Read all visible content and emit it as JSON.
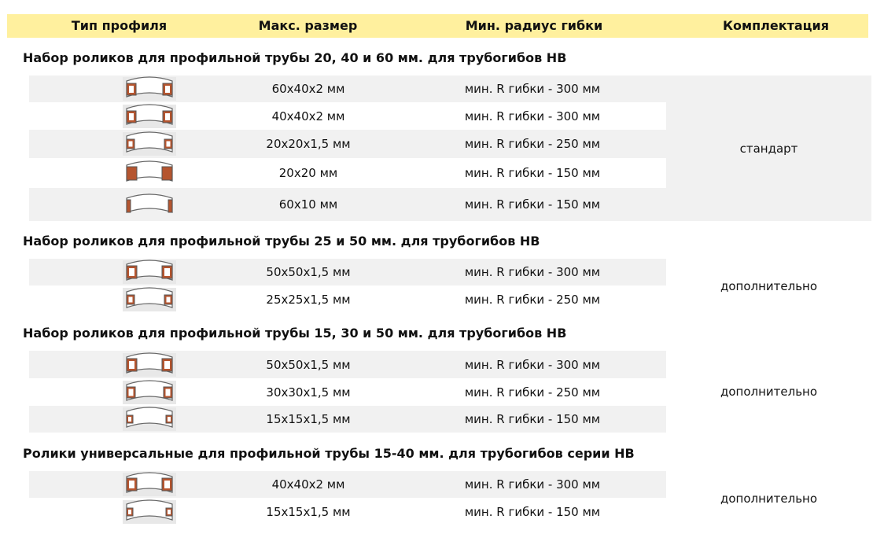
{
  "columns": {
    "type": "Тип профиля",
    "size": "Макс. размер",
    "radius": "Мин. радиус гибки",
    "kit": "Комплектация"
  },
  "groups": [
    {
      "title": "Набор роликов для профильной трубы 20, 40 и 60 мм. для трубогибов HB",
      "kit": "стандарт",
      "rows": [
        {
          "size": "60x40x2 мм",
          "radius": "мин. R гибки - 300 мм",
          "icon": "roller-hollow-square-icon"
        },
        {
          "size": "40x40x2 мм",
          "radius": "мин. R гибки - 300 мм",
          "icon": "roller-hollow-square-icon"
        },
        {
          "size": "20x20x1,5 мм",
          "radius": "мин. R гибки - 250 мм",
          "icon": "roller-hollow-square-icon"
        },
        {
          "size": "20x20 мм",
          "radius": "мин. R гибки - 150 мм",
          "icon": "roller-solid-square-icon"
        },
        {
          "size": "60x10 мм",
          "radius": "мин. R гибки - 150 мм",
          "icon": "roller-solid-flat-icon"
        }
      ]
    },
    {
      "title": "Набор роликов для профильной трубы 25 и 50 мм. для трубогибов HB",
      "kit": "дополнительно",
      "rows": [
        {
          "size": "50x50x1,5 мм",
          "radius": "мин. R гибки - 300 мм",
          "icon": "roller-hollow-square-icon"
        },
        {
          "size": "25x25x1,5 мм",
          "radius": "мин. R гибки - 250 мм",
          "icon": "roller-hollow-square-icon"
        }
      ]
    },
    {
      "title": "Набор роликов для профильной трубы 15, 30 и 50 мм. для трубогибов HB",
      "kit": "дополнительно",
      "rows": [
        {
          "size": "50x50x1,5 мм",
          "radius": "мин. R гибки - 300 мм",
          "icon": "roller-hollow-square-icon"
        },
        {
          "size": "30x30x1,5 мм",
          "radius": "мин. R гибки - 250 мм",
          "icon": "roller-hollow-square-icon"
        },
        {
          "size": "15x15x1,5 мм",
          "radius": "мин. R гибки - 150 мм",
          "icon": "roller-hollow-square-icon"
        }
      ]
    },
    {
      "title": "Ролики универсальные для профильной трубы 15-40 мм. для трубогибов серии HB",
      "kit": "дополнительно",
      "rows": [
        {
          "size": "40x40x2 мм",
          "radius": "мин. R гибки - 300 мм",
          "icon": "roller-hollow-square-icon"
        },
        {
          "size": "15x15x1,5 мм",
          "radius": "мин. R гибки - 150 мм",
          "icon": "roller-hollow-square-icon"
        }
      ]
    }
  ],
  "colors": {
    "header_bg": "#fff09e",
    "row_shade": "#f1f1f1",
    "profile_brown": "#b5552f",
    "profile_dark": "#8a3a1c"
  }
}
